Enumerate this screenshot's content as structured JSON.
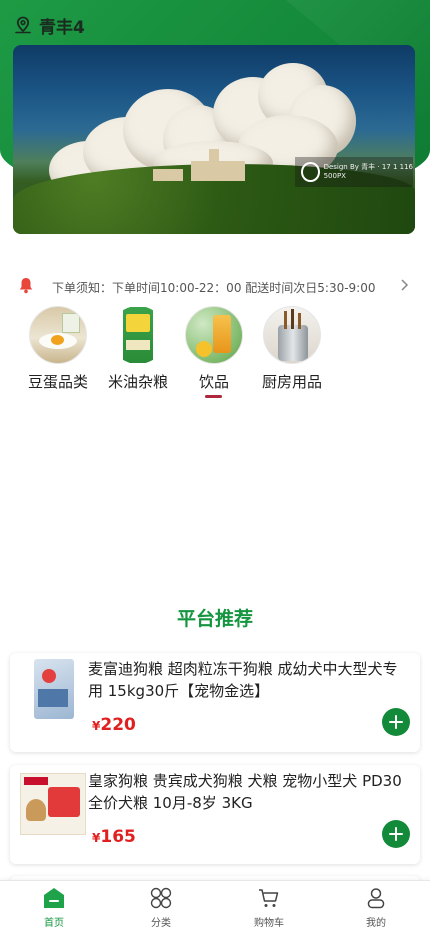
{
  "header": {
    "location": "青丰4"
  },
  "banner": {
    "watermark_line1": "Design By 青丰 · 17 1 116",
    "watermark_line2": "500PX"
  },
  "notice": {
    "text": "下单须知：下单时间10:00-22：00 配送时间次日5:30-9:00"
  },
  "categories": [
    {
      "label": "豆蛋品类"
    },
    {
      "label": "米油杂粮"
    },
    {
      "label": "饮品",
      "selected": true
    },
    {
      "label": "厨房用品"
    }
  ],
  "section_title": "平台推荐",
  "products": [
    {
      "title": "麦富迪狗粮 超肉粒冻干狗粮 成幼犬中大型犬专用 15kg30斤【宠物金选】",
      "currency": "¥",
      "price": "220"
    },
    {
      "title": "皇家狗粮 贵宾成犬狗粮 犬粮 宠物小型犬 PD30 全价犬粮 10月-8岁 3KG",
      "currency": "¥",
      "price": "165"
    }
  ],
  "tabbar": [
    {
      "label": "首页",
      "icon": "home-icon",
      "active": true
    },
    {
      "label": "分类",
      "icon": "category-icon"
    },
    {
      "label": "购物车",
      "icon": "cart-icon"
    },
    {
      "label": "我的",
      "icon": "user-icon"
    }
  ],
  "colors": {
    "brand_green": "#15953f",
    "price_red": "#e02020",
    "accent_red": "#b0263b"
  }
}
